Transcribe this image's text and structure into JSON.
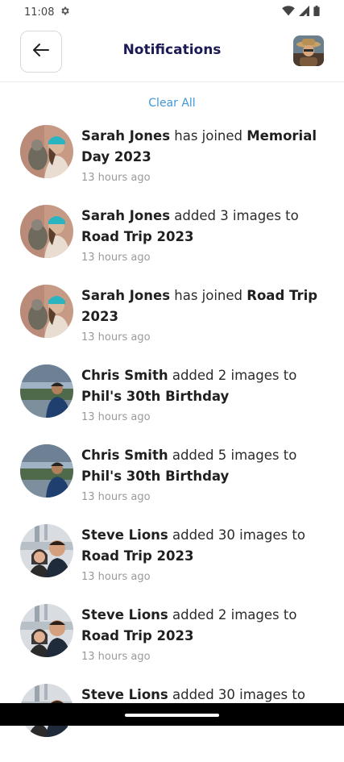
{
  "status_bar": {
    "time": "11:08"
  },
  "header": {
    "title": "Notifications"
  },
  "clear_all_label": "Clear All",
  "notifications": [
    {
      "actor": "Sarah Jones",
      "action": " has joined ",
      "target": "Memorial Day 2023",
      "time": "13 hours ago",
      "avatar": "sarah"
    },
    {
      "actor": "Sarah Jones",
      "action": " added 3 images to ",
      "target": "Road Trip 2023",
      "time": "13 hours ago",
      "avatar": "sarah"
    },
    {
      "actor": "Sarah Jones",
      "action": " has joined ",
      "target": "Road Trip 2023",
      "time": "13 hours ago",
      "avatar": "sarah"
    },
    {
      "actor": "Chris Smith",
      "action": " added 2 images to ",
      "target": "Phil's 30th Birthday",
      "time": "13 hours ago",
      "avatar": "chris"
    },
    {
      "actor": "Chris Smith",
      "action": " added 5 images to ",
      "target": "Phil's 30th Birthday",
      "time": "13 hours ago",
      "avatar": "chris"
    },
    {
      "actor": "Steve Lions",
      "action": " added 30 images to ",
      "target": "Road Trip 2023",
      "time": "13 hours ago",
      "avatar": "steve"
    },
    {
      "actor": "Steve Lions",
      "action": " added 2 images to ",
      "target": "Road Trip 2023",
      "time": "13 hours ago",
      "avatar": "steve"
    },
    {
      "actor": "Steve Lions",
      "action": " added 30 images to ",
      "target": "",
      "time": "",
      "avatar": "steve"
    }
  ]
}
